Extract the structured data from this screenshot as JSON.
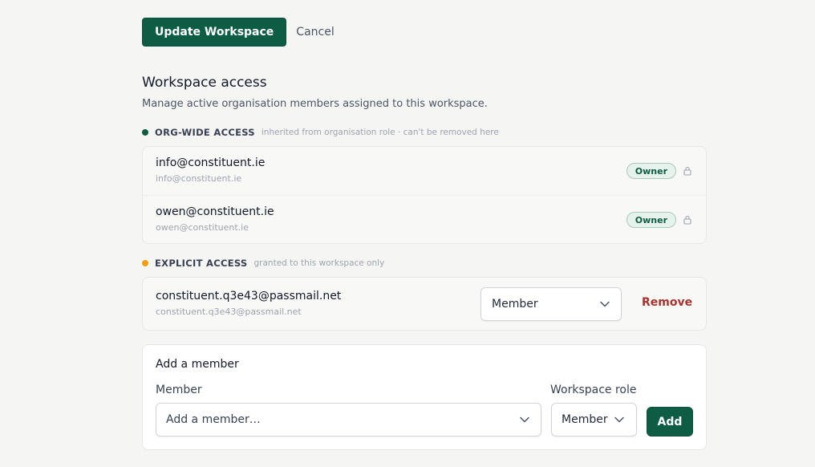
{
  "actions": {
    "primary_label": "Update Workspace",
    "cancel_label": "Cancel"
  },
  "section": {
    "title": "Workspace access",
    "description": "Manage active organisation members assigned to this workspace."
  },
  "org_wide": {
    "title": "ORG-WIDE ACCESS",
    "note": "inherited from organisation role · can't be removed here",
    "dot_color": "#0f5c45",
    "members": [
      {
        "name": "info@constituent.ie",
        "email": "info@constituent.ie",
        "role": "Owner"
      },
      {
        "name": "owen@constituent.ie",
        "email": "owen@constituent.ie",
        "role": "Owner"
      }
    ]
  },
  "explicit": {
    "title": "EXPLICIT ACCESS",
    "note": "granted to this workspace only",
    "dot_color": "#f59e0b",
    "members": [
      {
        "name": "constituent.q3e43@passmail.net",
        "email": "constituent.q3e43@passmail.net",
        "role": "Member",
        "remove_label": "Remove"
      }
    ]
  },
  "add_member": {
    "title": "Add a member",
    "member_label": "Member",
    "member_placeholder": "Add a member…",
    "role_label": "Workspace role",
    "role_value": "Member",
    "add_label": "Add"
  },
  "colors": {
    "accent": "#0f5c45",
    "danger": "#a8322d",
    "warning_dot": "#f59e0b"
  }
}
